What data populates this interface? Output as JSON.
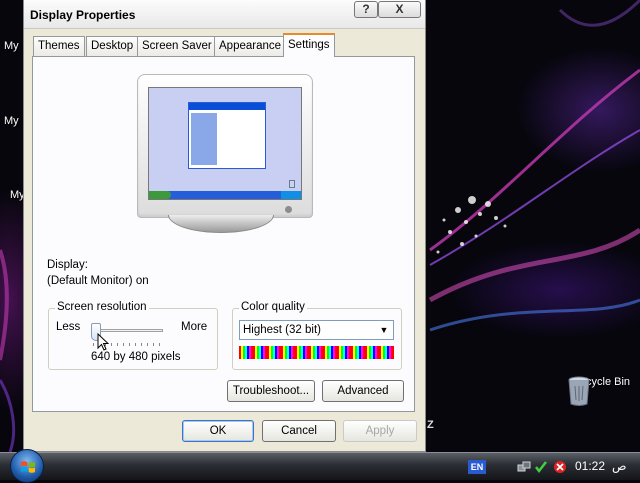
{
  "desktop": {
    "left_icons": [
      "My",
      "My",
      "My"
    ],
    "recycle_bin": "Recycle Bin",
    "stray_char": "Z"
  },
  "window": {
    "title": "Display Properties",
    "help_glyph": "?",
    "close_glyph": "X",
    "tabs": [
      {
        "label": "Themes"
      },
      {
        "label": "Desktop"
      },
      {
        "label": "Screen Saver"
      },
      {
        "label": "Appearance"
      },
      {
        "label": "Settings",
        "active": true
      }
    ],
    "display_label": "Display:",
    "display_value": "(Default Monitor) on",
    "screen_resolution": {
      "title": "Screen resolution",
      "less": "Less",
      "more": "More",
      "value": "640 by 480 pixels",
      "slider_level": 0
    },
    "color_quality": {
      "title": "Color quality",
      "selected": "Highest (32 bit)"
    },
    "buttons": {
      "troubleshoot": "Troubleshoot...",
      "advanced": "Advanced",
      "ok": "OK",
      "cancel": "Cancel",
      "apply": "Apply"
    }
  },
  "taskbar": {
    "language": "EN",
    "clock": "01:22",
    "ampm": "ص"
  },
  "colors": {
    "tab_highlight": "#e68b2c",
    "dialog_bg": "#ece9d8",
    "panel_bg": "#fcfcfe",
    "default_button_border": "#3b73c8"
  },
  "icons": [
    "help-icon",
    "close-icon",
    "dropdown-arrow-icon",
    "mouse-cursor-icon",
    "windows-start-icon",
    "recycle-bin-icon",
    "network-icon",
    "security-icon",
    "volume-icon"
  ]
}
